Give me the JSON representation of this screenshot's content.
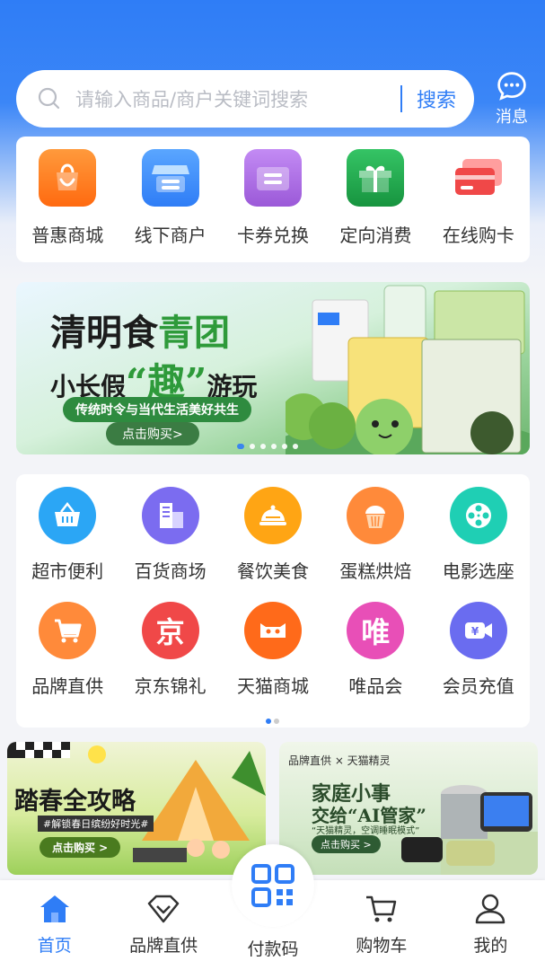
{
  "search": {
    "placeholder": "请输入商品/商户关键词搜索",
    "button": "搜索"
  },
  "message": {
    "label": "消息"
  },
  "quick_menu": [
    {
      "label": "普惠商城",
      "icon": "shopping-bag-icon",
      "color": "#ff7a1a"
    },
    {
      "label": "线下商户",
      "icon": "storefront-icon",
      "color": "#3a8ef6"
    },
    {
      "label": "卡券兑换",
      "icon": "ticket-icon",
      "color": "#9b59d8"
    },
    {
      "label": "定向消费",
      "icon": "gift-icon",
      "color": "#20a94e"
    },
    {
      "label": "在线购卡",
      "icon": "card-icon",
      "color": "#f04848"
    }
  ],
  "banner": {
    "title_line1_prefix": "清明食",
    "title_line1_highlight": "青团",
    "title_line2_prefix": "小长假",
    "title_line2_highlight": "“趣”",
    "title_line2_suffix": "游玩",
    "subtitle": "传统时令与当代生活美好共生",
    "cta": "点击购买>",
    "slides": 6,
    "active_slide": 0
  },
  "categories": [
    {
      "label": "超市便利",
      "icon": "basket-icon",
      "color": "#2ba6f5"
    },
    {
      "label": "百货商场",
      "icon": "building-icon",
      "color": "#7b6cf0"
    },
    {
      "label": "餐饮美食",
      "icon": "food-cloche-icon",
      "color": "#ffa514"
    },
    {
      "label": "蛋糕烘焙",
      "icon": "cupcake-icon",
      "color": "#ff8a3a"
    },
    {
      "label": "电影选座",
      "icon": "film-reel-icon",
      "color": "#1fcfb4"
    },
    {
      "label": "品牌直供",
      "icon": "cart-icon",
      "color": "#ff8a3a"
    },
    {
      "label": "京东锦礼",
      "icon": "jd-icon",
      "color": "#f04848",
      "glyph": "京"
    },
    {
      "label": "天猫商城",
      "icon": "tmall-icon",
      "color": "#ff6a1a"
    },
    {
      "label": "唯品会",
      "icon": "vip-icon",
      "color": "#e84fb7",
      "glyph": "唯"
    },
    {
      "label": "会员充值",
      "icon": "video-icon",
      "color": "#6a6cf0"
    }
  ],
  "promo_left": {
    "title": "踏春全攻略",
    "subtitle": "#解锁春日缤纷好时光#",
    "cta": "点击购买 >"
  },
  "promo_right": {
    "brand": "品牌直供 × 天猫精灵",
    "title_line1": "家庭小事",
    "title_line2": "交给“AI管家”",
    "subtitle": "“天猫精灵，空调睡眠模式”",
    "cta": "点击购买 >"
  },
  "bottom_nav": [
    {
      "label": "首页",
      "icon": "home-icon",
      "active": true
    },
    {
      "label": "品牌直供",
      "icon": "diamond-icon",
      "active": false
    },
    {
      "label": "付款码",
      "icon": "qr-code-icon",
      "active": false
    },
    {
      "label": "购物车",
      "icon": "cart-outline-icon",
      "active": false
    },
    {
      "label": "我的",
      "icon": "user-icon",
      "active": false
    }
  ],
  "colors": {
    "primary": "#2f7df6"
  }
}
